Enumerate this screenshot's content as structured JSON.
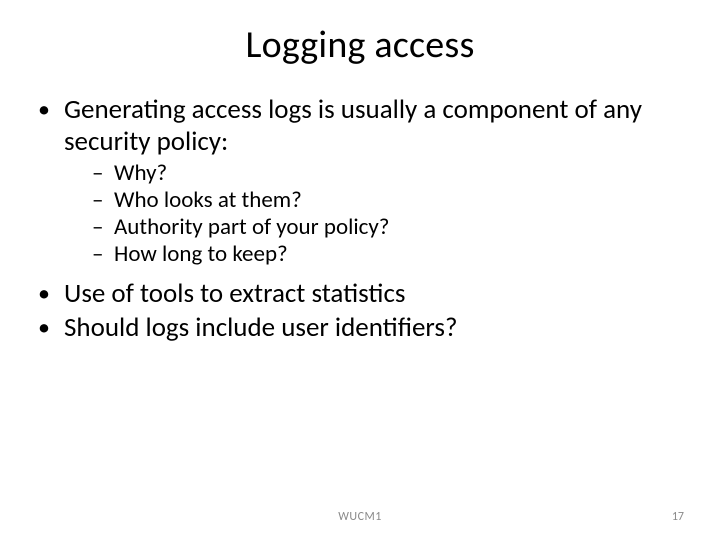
{
  "title": "Logging access",
  "bullets": [
    {
      "text": "Generating access logs is usually a component of any security policy:",
      "sub": [
        "Why?",
        "Who looks at them?",
        "Authority part of your policy?",
        "How long to keep?"
      ]
    },
    {
      "text": "Use of tools to extract statistics",
      "sub": []
    },
    {
      "text": "Should logs include user identifiers?",
      "sub": []
    }
  ],
  "footer": {
    "center": "WUCM1",
    "page": "17"
  }
}
